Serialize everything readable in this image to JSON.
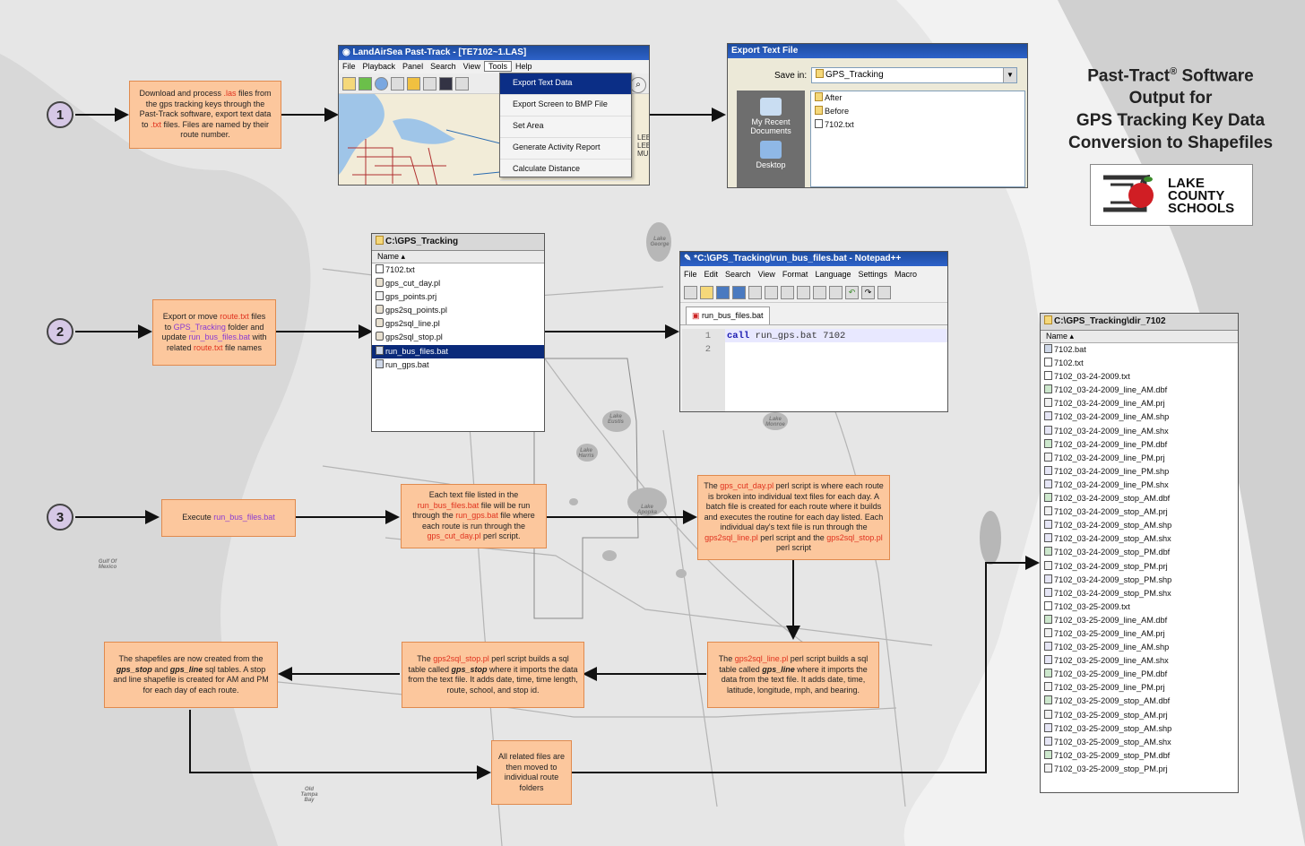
{
  "title": {
    "line1": "Past-Tract",
    "reg": "®",
    "line1b": " Software",
    "line2": "Output for",
    "line3": "GPS Tracking Key Data",
    "line4": "Conversion to Shapefiles"
  },
  "logo": {
    "line1": "LAKE",
    "line2": "COUNTY",
    "line3": "SCHOOLS"
  },
  "steps": {
    "s1": "1",
    "s2": "2",
    "s3": "3"
  },
  "notes": {
    "n1": {
      "a": "Download and process ",
      "b": ".las",
      "c": " files from the gps tracking keys through the Past-Track software, export text data to ",
      "d": ".txt",
      "e": " files. Files are named by their route number."
    },
    "n2": {
      "a": "Export or move ",
      "b": "route.txt",
      "c": " files to ",
      "d": "GPS_Tracking",
      "e": " folder and update ",
      "f": "run_bus_files.bat",
      "g": " with related ",
      "h": "route.txt",
      "i": " file names"
    },
    "n3": {
      "a": "Execute ",
      "b": "run_bus_files.bat"
    },
    "n4": {
      "a": "Each text file listed in the ",
      "b": "run_bus_files.bat",
      "c": " file will be run through the ",
      "d": "run_gps.bat",
      "e": " file where each route is run through the ",
      "f": "gps_cut_day.pl",
      "g": " perl script."
    },
    "n5": {
      "a": "The ",
      "b": "gps_cut_day.pl",
      "c": " perl script is where each route is broken into individual text files for each day.  A batch file is created for each route where it builds and executes the routine for each day listed. Each individual day's text file is run through the ",
      "d": "gps2sql_line.pl",
      "e": " perl script and the ",
      "f": "gps2sql_stop.pl",
      "g": " perl script"
    },
    "n6": {
      "a": "The ",
      "b": "gps2sql_line.pl",
      "c": " perl script builds a sql table called ",
      "d": "gps_line",
      "e": " where it imports the data from the text file.  It adds date, time, latitude, longitude, mph, and bearing."
    },
    "n7": {
      "a": "The ",
      "b": "gps2sql_stop.pl",
      "c": " perl script builds a sql table called ",
      "d": "gps_stop",
      "e": " where it imports the data from the text file.  It adds date, time, time length, route, school, and stop id."
    },
    "n8": {
      "a": "The shapefiles are now created from the ",
      "b": "gps_stop",
      "c": " and ",
      "d": "gps_line",
      "e": " sql tables.  A stop and line shapefile is created for AM and PM for each day of each route."
    },
    "n9": {
      "a": "All related files are then moved to individual route folders"
    }
  },
  "pasttrack": {
    "title": "LandAirSea Past-Track - [TE7102~1.LAS]",
    "menu": [
      "File",
      "Playback",
      "Panel",
      "Search",
      "View",
      "Tools",
      "Help"
    ],
    "dropdown": [
      "Export Text Data",
      "Export Screen to BMP File",
      "Set Area",
      "Generate Activity Report",
      "Calculate Distance"
    ],
    "map_text": [
      "LEE",
      "LEE",
      "MU"
    ]
  },
  "export": {
    "title": "Export Text File",
    "savein_label": "Save in:",
    "savein_value": "GPS_Tracking",
    "places": [
      "My Recent Documents",
      "Desktop"
    ],
    "files": [
      "After",
      "Before",
      "7102.txt"
    ]
  },
  "explorer1": {
    "title": "C:\\GPS_Tracking",
    "header": "Name",
    "files": [
      "7102.txt",
      "gps_cut_day.pl",
      "gps_points.prj",
      "gps2sq_points.pl",
      "gps2sql_line.pl",
      "gps2sql_stop.pl",
      "run_bus_files.bat",
      "run_gps.bat"
    ],
    "selected": 6
  },
  "notepad": {
    "title": "*C:\\GPS_Tracking\\run_bus_files.bat - Notepad++",
    "menu": [
      "File",
      "Edit",
      "Search",
      "View",
      "Format",
      "Language",
      "Settings",
      "Macro"
    ],
    "tab": "run_bus_files.bat",
    "lines": [
      {
        "num": "1",
        "kw": "call",
        "rest": " run_gps.bat",
        "num2": " 7102"
      },
      {
        "num": "2",
        "kw": "",
        "rest": "",
        "num2": ""
      }
    ]
  },
  "explorer2": {
    "title": "C:\\GPS_Tracking\\dir_7102",
    "header": "Name",
    "files": [
      "7102.bat",
      "7102.txt",
      "7102_03-24-2009.txt",
      "7102_03-24-2009_line_AM.dbf",
      "7102_03-24-2009_line_AM.prj",
      "7102_03-24-2009_line_AM.shp",
      "7102_03-24-2009_line_AM.shx",
      "7102_03-24-2009_line_PM.dbf",
      "7102_03-24-2009_line_PM.prj",
      "7102_03-24-2009_line_PM.shp",
      "7102_03-24-2009_line_PM.shx",
      "7102_03-24-2009_stop_AM.dbf",
      "7102_03-24-2009_stop_AM.prj",
      "7102_03-24-2009_stop_AM.shp",
      "7102_03-24-2009_stop_AM.shx",
      "7102_03-24-2009_stop_PM.dbf",
      "7102_03-24-2009_stop_PM.prj",
      "7102_03-24-2009_stop_PM.shp",
      "7102_03-24-2009_stop_PM.shx",
      "7102_03-25-2009.txt",
      "7102_03-25-2009_line_AM.dbf",
      "7102_03-25-2009_line_AM.prj",
      "7102_03-25-2009_line_AM.shp",
      "7102_03-25-2009_line_AM.shx",
      "7102_03-25-2009_line_PM.dbf",
      "7102_03-25-2009_line_PM.prj",
      "7102_03-25-2009_stop_AM.dbf",
      "7102_03-25-2009_stop_AM.prj",
      "7102_03-25-2009_stop_AM.shp",
      "7102_03-25-2009_stop_AM.shx",
      "7102_03-25-2009_stop_PM.dbf",
      "7102_03-25-2009_stop_PM.prj"
    ]
  },
  "map_labels": {
    "gulf1": "Gulf Of",
    "gulf2": "Mexico",
    "lake_george": "Lake George",
    "lake_eustis": "Lake Eustis",
    "lake_harris": "Lake Harris",
    "lake_apopka": "Lake Apopka",
    "lake_monroe": "Lake Monroe",
    "tampa": "Old Tampa Bay"
  },
  "colors": {
    "note_fill": "#fcc79d",
    "note_border": "#e08a4e",
    "highlight_red": "#e0321e",
    "highlight_purple": "#8a3bd2",
    "step_fill": "#d6c8e6",
    "selection": "#0a2a7a"
  }
}
